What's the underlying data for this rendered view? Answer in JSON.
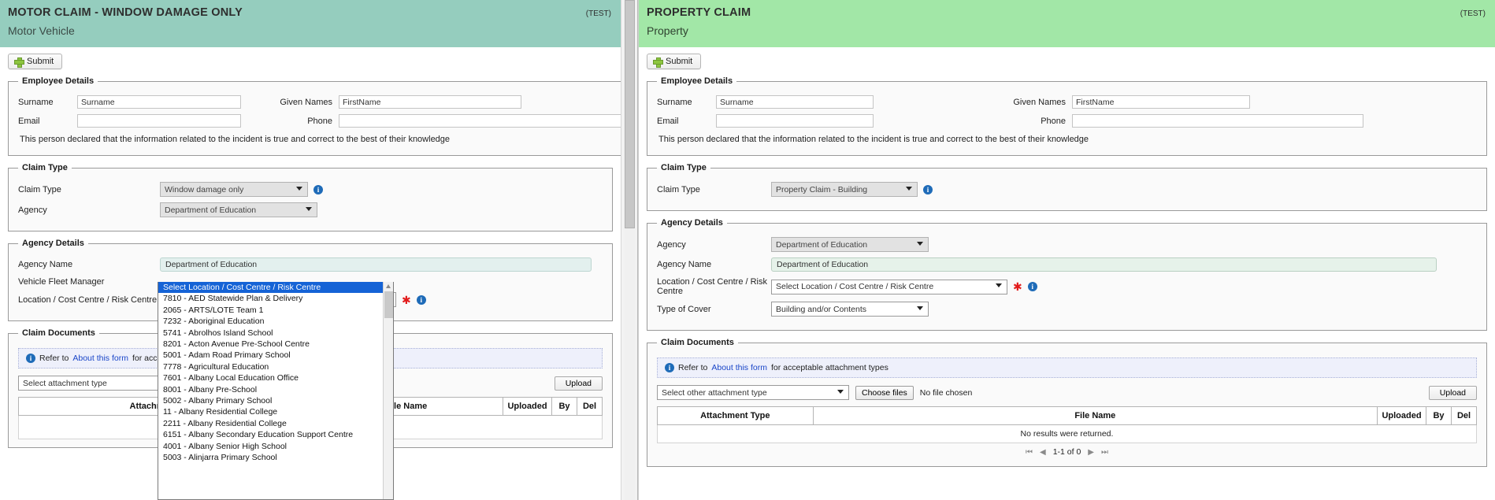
{
  "motor": {
    "header": {
      "title": "MOTOR CLAIM - WINDOW DAMAGE ONLY",
      "subtitle": "Motor Vehicle",
      "test_tag": "(TEST)",
      "bg": "#95cdbe"
    },
    "submit_label": "Submit",
    "employee": {
      "legend": "Employee Details",
      "surname_label": "Surname",
      "surname_value": "Surname",
      "given_label": "Given Names",
      "given_value": "FirstName",
      "email_label": "Email",
      "email_value": "",
      "phone_label": "Phone",
      "phone_value": "",
      "declaration": "This person declared that the information related to the incident is true and correct to the best of their knowledge"
    },
    "claim_type": {
      "legend": "Claim Type",
      "type_label": "Claim Type",
      "type_value": "Window damage only",
      "agency_label": "Agency",
      "agency_value": "Department of Education"
    },
    "agency": {
      "legend": "Agency Details",
      "name_label": "Agency Name",
      "name_value": "Department of Education",
      "fleet_label": "Vehicle Fleet Manager",
      "fleet_value": "",
      "location_label": "Location / Cost Centre / Risk Centre",
      "location_value": "Select Location / Cost Centre / Risk Centre"
    },
    "documents": {
      "legend": "Claim Documents",
      "note_prefix": "Refer to ",
      "note_link": "About this form",
      "note_suffix": " for acceptable attachment types",
      "attachment_select": "Select attachment type",
      "upload_label": "Upload",
      "columns": [
        "Attachment Type",
        "File Name",
        "Uploaded",
        "By",
        "Del"
      ]
    },
    "dropdown_options": [
      "Select Location / Cost Centre / Risk Centre",
      "7810 - AED Statewide Plan & Delivery",
      "2065 - ARTS/LOTE Team 1",
      "7232 - Aboriginal Education",
      "5741 - Abrolhos Island School",
      "8201 - Acton Avenue Pre-School Centre",
      "5001 - Adam Road Primary School",
      "7778 - Agricultural Education",
      "7601 - Albany Local Education Office",
      "8001 - Albany Pre-School",
      "5002 - Albany Primary School",
      "11 - Albany Residential College",
      "2211 - Albany Residential College",
      "6151 - Albany Secondary Education Support Centre",
      "4001 - Albany Senior High School",
      "5003 - Alinjarra Primary School"
    ]
  },
  "property": {
    "header": {
      "title": "PROPERTY CLAIM",
      "subtitle": "Property",
      "test_tag": "(TEST)",
      "bg": "#a2e7a7"
    },
    "submit_label": "Submit",
    "employee": {
      "legend": "Employee Details",
      "surname_label": "Surname",
      "surname_value": "Surname",
      "given_label": "Given Names",
      "given_value": "FirstName",
      "email_label": "Email",
      "email_value": "",
      "phone_label": "Phone",
      "phone_value": "",
      "declaration": "This person declared that the information related to the incident is true and correct to the best of their knowledge"
    },
    "claim_type": {
      "legend": "Claim Type",
      "type_label": "Claim Type",
      "type_value": "Property Claim - Building"
    },
    "agency": {
      "legend": "Agency Details",
      "agency_label": "Agency",
      "agency_value": "Department of Education",
      "name_label": "Agency Name",
      "name_value": "Department of Education",
      "location_label": "Location / Cost Centre / Risk Centre",
      "location_value": "Select Location / Cost Centre / Risk Centre",
      "cover_label": "Type of Cover",
      "cover_value": "Building and/or Contents"
    },
    "documents": {
      "legend": "Claim Documents",
      "note_prefix": "Refer to ",
      "note_link": "About this form",
      "note_suffix": " for acceptable attachment types",
      "attachment_select": "Select other attachment type",
      "choose_files_label": "Choose files",
      "no_file_text": "No file chosen",
      "upload_label": "Upload",
      "columns": [
        "Attachment Type",
        "File Name",
        "Uploaded",
        "By",
        "Del"
      ],
      "empty_text": "No results were returned.",
      "pager": {
        "first": "⏮",
        "prev": "◀",
        "range": "1-1 of 0",
        "next": "▶",
        "last": "⏭"
      }
    }
  }
}
